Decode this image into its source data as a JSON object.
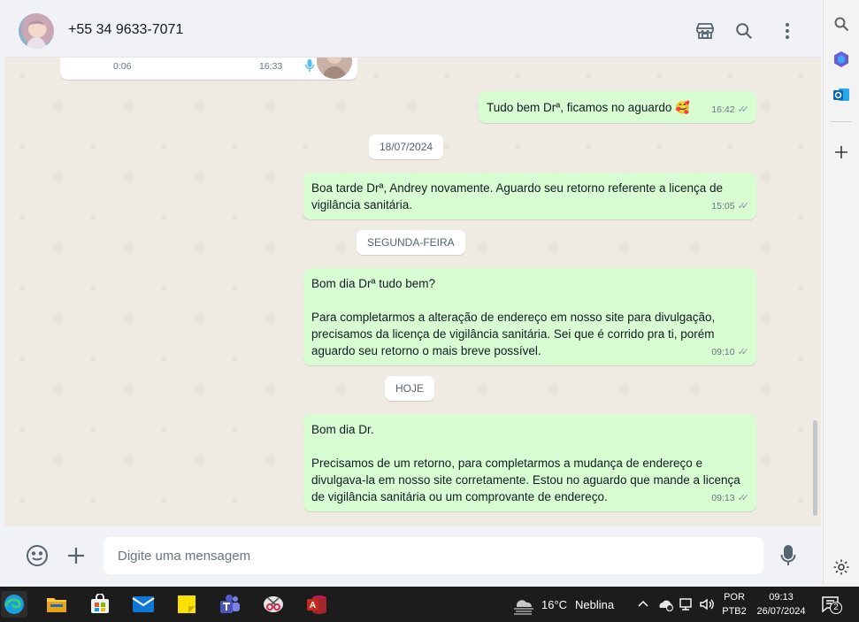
{
  "header": {
    "contact": "+55 34 9633-7071",
    "icons": [
      "store-icon",
      "search-icon",
      "menu-dots-icon"
    ]
  },
  "messages": [
    {
      "kind": "in",
      "partial": true,
      "duration": "0:06",
      "time": "16:33"
    },
    {
      "kind": "out",
      "text": "Tudo bem Drª, ficamos no aguardo 🥰",
      "time": "16:42"
    },
    {
      "kind": "date",
      "text": "18/07/2024"
    },
    {
      "kind": "out",
      "text": "Boa tarde Drª, Andrey novamente. Aguardo seu retorno referente a licença de vigilância sanitária.",
      "time": "15:05"
    },
    {
      "kind": "date",
      "text": "SEGUNDA-FEIRA"
    },
    {
      "kind": "out",
      "text": "Bom dia Drª tudo bem?\n\nPara completarmos a alteração de endereço em nosso site para divulgação, precisamos da licença de vigilância sanitária. Sei que é corrido pra ti, porém aguardo seu retorno o mais breve possível.",
      "time": "09:10"
    },
    {
      "kind": "date",
      "text": "HOJE"
    },
    {
      "kind": "out",
      "text": "Bom dia Dr.\n\nPrecisamos de um retorno, para completarmos a mudança de endereço e divulgava-la em nosso site corretamente. Estou no aguardo que mande a licença de vigilância sanitária ou um comprovante de endereço.",
      "time": "09:13"
    }
  ],
  "composer": {
    "placeholder": "Digite uma mensagem",
    "icons": [
      "emoji-icon",
      "plus-icon",
      "mic-icon"
    ]
  },
  "edge_bar": {
    "icons": [
      "search-icon",
      "copilot-icon",
      "outlook-icon",
      "plus-icon",
      "settings-icon"
    ]
  },
  "taskbar": {
    "apps": [
      "edge-icon",
      "file-explorer-icon",
      "store-icon",
      "mail-icon",
      "sticky-notes-icon",
      "teams-icon",
      "snipping-tool-icon",
      "access-icon"
    ],
    "weather_temp": "16°C",
    "weather_text": "Neblina",
    "lang_1": "POR",
    "lang_2": "PTB2",
    "time": "09:13",
    "date": "26/07/2024",
    "notification_count": "2"
  },
  "colors": {
    "outgoing_bubble": "#d9fdd3",
    "chat_background": "#efeae2",
    "header_background": "#f0f2f5"
  }
}
